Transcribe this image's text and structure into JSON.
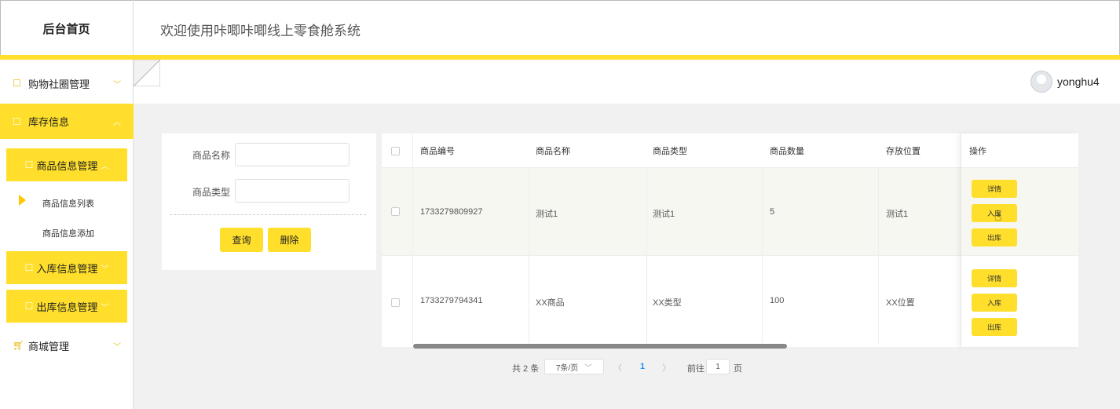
{
  "header": {
    "logo": "后台首页",
    "title": "欢迎使用咔唧咔唧线上零食舱系统",
    "username": "yonghu4"
  },
  "sidebar": {
    "menu1": "购物社圈管理",
    "menu2": "库存信息",
    "sub1": "商品信息管理",
    "leaf1": "商品信息列表",
    "leaf2": "商品信息添加",
    "sub2": "入库信息管理",
    "sub3": "出库信息管理",
    "menu3": "商城管理"
  },
  "search": {
    "name_label": "商品名称",
    "type_label": "商品类型",
    "query_btn": "查询",
    "delete_btn": "删除"
  },
  "table": {
    "headers": [
      "商品编号",
      "商品名称",
      "商品类型",
      "商品数量",
      "存放位置",
      "操作"
    ],
    "rows": [
      {
        "id": "1733279809927",
        "name": "测试1",
        "type": "测试1",
        "qty": "5",
        "loc": "测试1"
      },
      {
        "id": "1733279794341",
        "name": "XX商品",
        "type": "XX类型",
        "qty": "100",
        "loc": "XX位置"
      }
    ],
    "actions": {
      "detail": "详情",
      "in": "入库",
      "out": "出库"
    }
  },
  "pagination": {
    "total": "共 2 条",
    "page_size": "7条/页",
    "current": "1",
    "goto": "前往",
    "goto_value": "1",
    "page_suffix": "页"
  }
}
